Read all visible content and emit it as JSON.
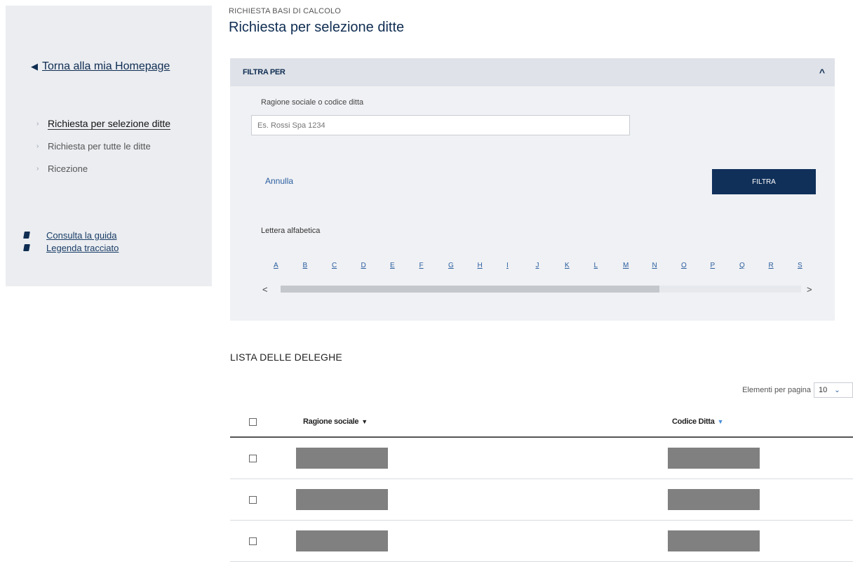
{
  "sidebar": {
    "back_link": "Torna alla mia Homepage",
    "nav": [
      {
        "label": "Richiesta per selezione ditte",
        "active": true
      },
      {
        "label": "Richiesta per tutte le ditte",
        "active": false
      },
      {
        "label": "Ricezione",
        "active": false
      }
    ],
    "links": [
      {
        "label": "Consulta la guida",
        "icon": "book-icon"
      },
      {
        "label": "Legenda tracciato",
        "icon": "book-icon"
      }
    ]
  },
  "header": {
    "breadcrumb": "RICHIESTA BASI DI CALCOLO",
    "title": "Richiesta per selezione ditte"
  },
  "filter": {
    "title": "FILTRA PER",
    "field_label": "Ragione sociale o codice ditta",
    "field_placeholder": "Es. Rossi Spa 1234",
    "field_value": "",
    "cancel_label": "Annulla",
    "submit_label": "FILTRA",
    "letters_label": "Lettera alfabetica",
    "letters": [
      "A",
      "B",
      "C",
      "D",
      "E",
      "F",
      "G",
      "H",
      "I",
      "J",
      "K",
      "L",
      "M",
      "N",
      "O",
      "P",
      "Q",
      "R",
      "S"
    ]
  },
  "list": {
    "title": "LISTA DELLE DELEGHE",
    "per_page_label": "Elementi per pagina",
    "per_page_value": "10",
    "columns": [
      "Ragione sociale",
      "Codice Ditta"
    ],
    "rows_redacted": 3
  },
  "colors": {
    "primary": "#10305a",
    "link": "#2a5ea0",
    "panel_bg": "#f0f1f4",
    "sidebar_bg": "#ebedf1"
  }
}
